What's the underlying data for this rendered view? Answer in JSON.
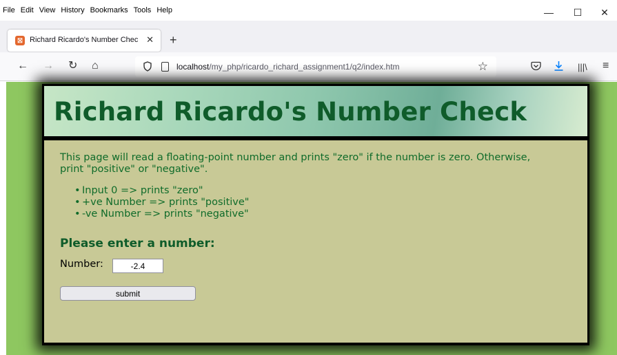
{
  "menu": {
    "items": [
      "File",
      "Edit",
      "View",
      "History",
      "Bookmarks",
      "Tools",
      "Help"
    ]
  },
  "window_controls": {
    "minimize": "—",
    "maximize": "☐",
    "close": "✕"
  },
  "tab": {
    "favicon": "⛝",
    "title": "Richard Ricardo's Number Chec",
    "close": "✕",
    "new_tab": "+"
  },
  "nav": {
    "back": "←",
    "forward": "→",
    "reload": "↻",
    "home": "⌂",
    "url_host": "localhost",
    "url_path": "/my_php/ricardo_richard_assignment1/q2/index.htm",
    "bookmark_star": "☆",
    "pocket_icon": "pocket-icon",
    "downloads_icon": "download-icon",
    "library": "|||\\",
    "menu": "≡"
  },
  "page": {
    "heading": "Richard Ricardo's Number Check",
    "intro": "This page will read a floating-point number and prints \"zero\" if the number is zero. Otherwise, print \"positive\" or \"negative\".",
    "rules": [
      "Input 0 => prints \"zero\"",
      "+ve Number => prints \"positive\"",
      "-ve Number => prints \"negative\""
    ],
    "prompt": "Please enter a number:",
    "number_label": "Number:",
    "number_value": "-2.4",
    "submit_label": "submit"
  },
  "colors": {
    "page_bg": "#8ec760",
    "content_bg": "#c8c996",
    "heading_text": "#0f5c2a",
    "body_text": "#0f6b2a"
  }
}
